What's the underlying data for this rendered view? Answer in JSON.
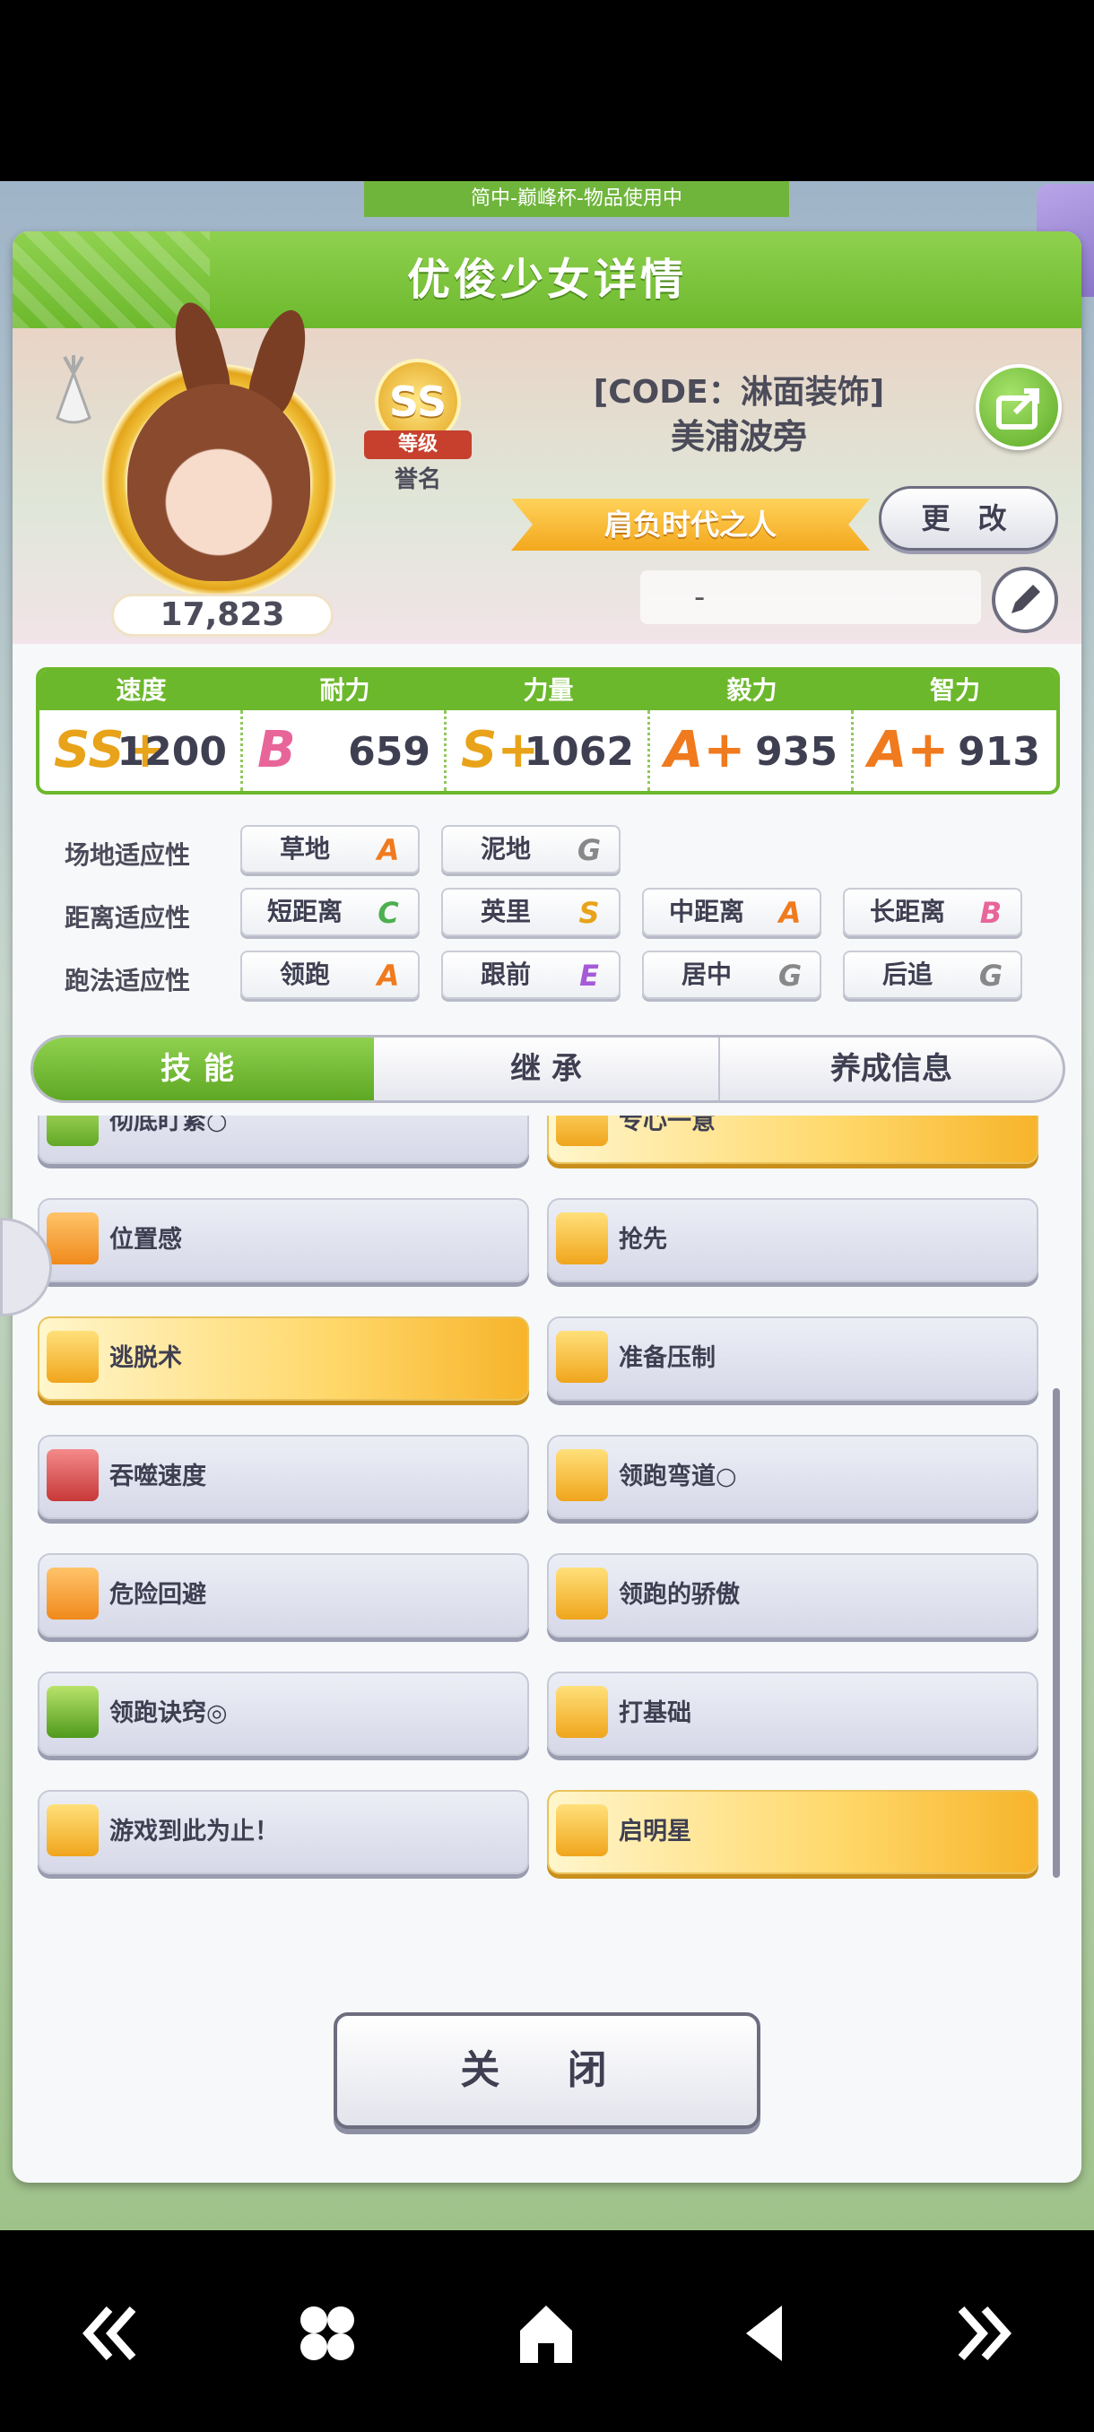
{
  "status_banner": "简中-巅峰杯-物品使用中",
  "dialog": {
    "title": "优俊少女详情"
  },
  "profile": {
    "fan_count": "17,823",
    "rank": {
      "grade": "SS",
      "ribbon": "等级",
      "sub": "誉名"
    },
    "title": "[CODE：淋面装饰]",
    "name": "美浦波旁",
    "epithet": "肩负时代之人",
    "change_label": "更 改",
    "comment": "-"
  },
  "stats": [
    {
      "label": "速度",
      "grade": "SS+",
      "value": "1200",
      "color": "#e8a31a"
    },
    {
      "label": "耐力",
      "grade": "B",
      "value": "659",
      "color": "#e8659a"
    },
    {
      "label": "力量",
      "grade": "S+",
      "value": "1062",
      "color": "#e8a31a"
    },
    {
      "label": "毅力",
      "grade": "A+",
      "value": "935",
      "color": "#f07a1e"
    },
    {
      "label": "智力",
      "grade": "A+",
      "value": "913",
      "color": "#f07a1e"
    }
  ],
  "aptitude": {
    "track_label": "场地适应性",
    "distance_label": "距离适应性",
    "style_label": "跑法适应性",
    "track": [
      {
        "name": "草地",
        "grade": "A"
      },
      {
        "name": "泥地",
        "grade": "G"
      }
    ],
    "distance": [
      {
        "name": "短距离",
        "grade": "C"
      },
      {
        "name": "英里",
        "grade": "S"
      },
      {
        "name": "中距离",
        "grade": "A"
      },
      {
        "name": "长距离",
        "grade": "B"
      }
    ],
    "style": [
      {
        "name": "领跑",
        "grade": "A"
      },
      {
        "name": "跟前",
        "grade": "E"
      },
      {
        "name": "居中",
        "grade": "G"
      },
      {
        "name": "后追",
        "grade": "G"
      }
    ]
  },
  "tabs": [
    {
      "label": "技能"
    },
    {
      "label": "继 承"
    },
    {
      "label": "养成信息"
    }
  ],
  "skills": [
    {
      "name": "彻底盯紧○",
      "gold": false,
      "icon": "green-gauge-icon"
    },
    {
      "name": "专心一意",
      "gold": true,
      "icon": "gate-icon"
    },
    {
      "name": "位置感",
      "gold": false,
      "icon": "position-arrow-icon"
    },
    {
      "name": "抢先",
      "gold": false,
      "icon": "running-speed-icon"
    },
    {
      "name": "逃脱术",
      "gold": true,
      "icon": "running-speed-icon"
    },
    {
      "name": "准备压制",
      "gold": false,
      "icon": "running-speed-icon"
    },
    {
      "name": "吞噬速度",
      "gold": false,
      "icon": "debuff-speed-icon"
    },
    {
      "name": "领跑弯道○",
      "gold": false,
      "icon": "running-speed-icon"
    },
    {
      "name": "危险回避",
      "gold": false,
      "icon": "position-arrow-icon"
    },
    {
      "name": "领跑的骄傲",
      "gold": false,
      "icon": "running-speed-icon"
    },
    {
      "name": "领跑诀窍◎",
      "gold": false,
      "icon": "book-icon"
    },
    {
      "name": "打基础",
      "gold": false,
      "icon": "running-speed-icon"
    },
    {
      "name": "游戏到此为止！",
      "gold": false,
      "icon": "running-speed-icon"
    },
    {
      "name": "启明星",
      "gold": true,
      "icon": "running-speed-icon"
    }
  ],
  "close_label": "关 闭",
  "navbar": [
    {
      "icon": "double-left-icon"
    },
    {
      "icon": "apps-icon"
    },
    {
      "icon": "home-icon"
    },
    {
      "icon": "back-triangle-icon"
    },
    {
      "icon": "double-right-icon"
    }
  ]
}
